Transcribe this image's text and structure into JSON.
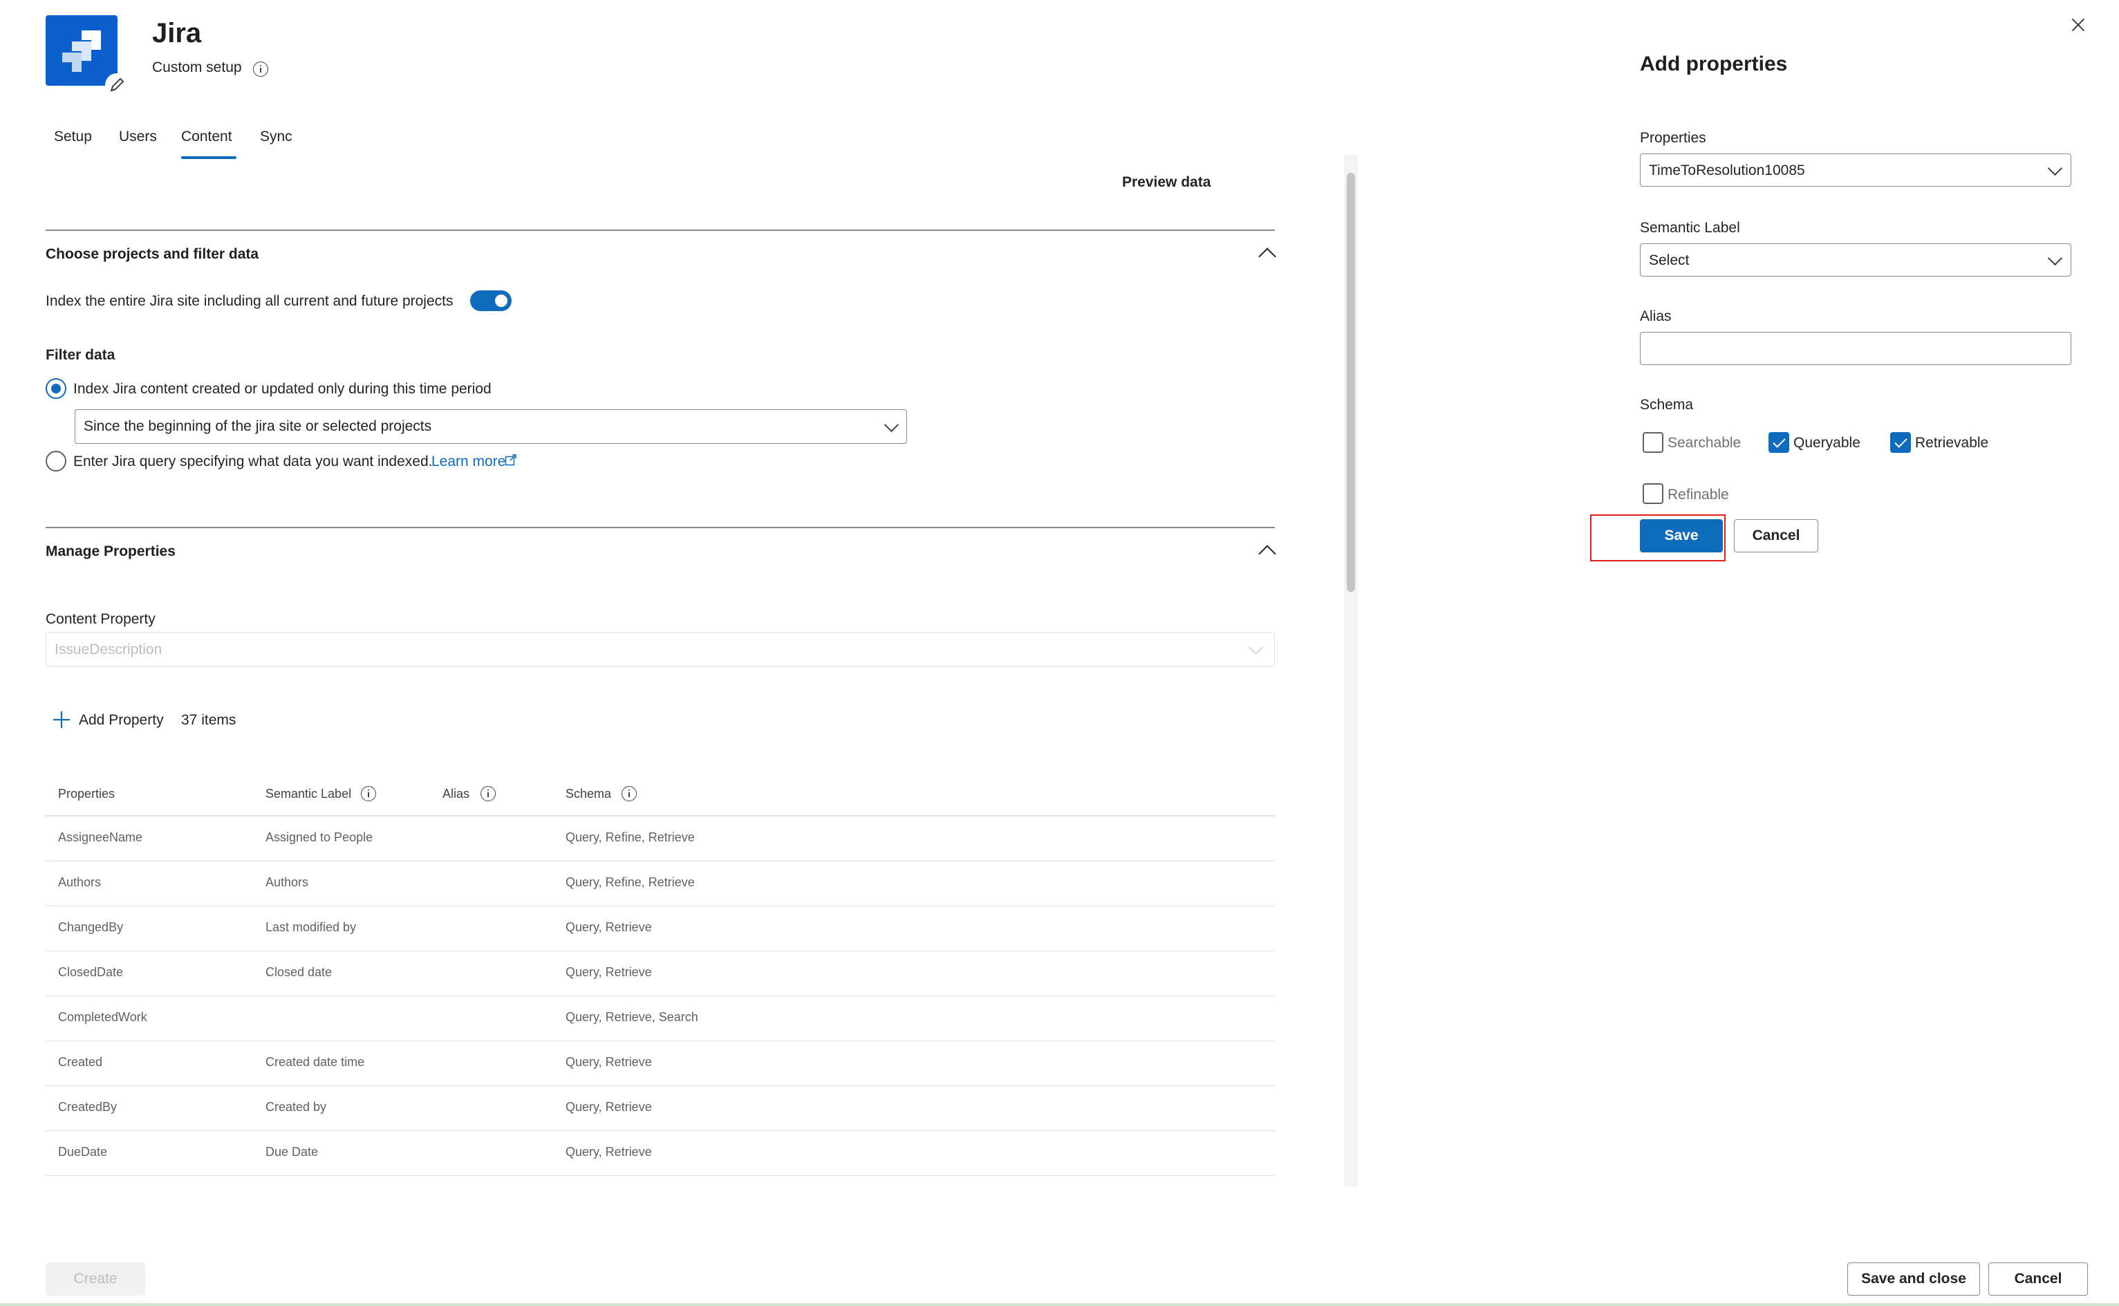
{
  "app": {
    "title": "Jira",
    "subtitle": "Custom setup"
  },
  "tabs": [
    {
      "label": "Setup"
    },
    {
      "label": "Users"
    },
    {
      "label": "Content",
      "active": true
    },
    {
      "label": "Sync"
    }
  ],
  "preview_data": "Preview data",
  "filter_section": {
    "title": "Choose projects and filter data",
    "index_entire_label": "Index the entire Jira site including all current and future projects",
    "index_entire_on": true,
    "filter_heading": "Filter data",
    "radio_time_period_label": "Index Jira content created or updated only during this time period",
    "time_period_value": "Since the beginning of the jira site or selected projects",
    "radio_query_label": "Enter Jira query specifying what data you want indexed.",
    "learn_more": "Learn more"
  },
  "manage_section": {
    "title": "Manage Properties",
    "content_property_label": "Content Property",
    "content_property_placeholder": "IssueDescription",
    "add_property": "Add Property",
    "items_count": "37 items",
    "columns": [
      "Properties",
      "Semantic Label",
      "Alias",
      "Schema"
    ],
    "rows": [
      {
        "property": "AssigneeName",
        "semantic": "Assigned to People",
        "alias": "",
        "schema": "Query, Refine, Retrieve"
      },
      {
        "property": "Authors",
        "semantic": "Authors",
        "alias": "",
        "schema": "Query, Refine, Retrieve"
      },
      {
        "property": "ChangedBy",
        "semantic": "Last modified by",
        "alias": "",
        "schema": "Query, Retrieve"
      },
      {
        "property": "ClosedDate",
        "semantic": "Closed date",
        "alias": "",
        "schema": "Query, Retrieve"
      },
      {
        "property": "CompletedWork",
        "semantic": "",
        "alias": "",
        "schema": "Query, Retrieve, Search"
      },
      {
        "property": "Created",
        "semantic": "Created date time",
        "alias": "",
        "schema": "Query, Retrieve"
      },
      {
        "property": "CreatedBy",
        "semantic": "Created by",
        "alias": "",
        "schema": "Query, Retrieve"
      },
      {
        "property": "DueDate",
        "semantic": "Due Date",
        "alias": "",
        "schema": "Query, Retrieve"
      }
    ]
  },
  "footer": {
    "create": "Create",
    "save_and_close": "Save and close",
    "cancel": "Cancel"
  },
  "panel": {
    "title": "Add properties",
    "properties_label": "Properties",
    "properties_value": "TimeToResolution10085",
    "semantic_label": "Semantic Label",
    "semantic_value": "Select",
    "alias_label": "Alias",
    "alias_value": "",
    "schema_label": "Schema",
    "schema": {
      "searchable": {
        "label": "Searchable",
        "checked": false
      },
      "queryable": {
        "label": "Queryable",
        "checked": true
      },
      "retrievable": {
        "label": "Retrievable",
        "checked": true
      },
      "refinable": {
        "label": "Refinable",
        "checked": false
      }
    },
    "save": "Save",
    "cancel": "Cancel"
  },
  "colors": {
    "accent": "#0f6cbd",
    "logo": "#0b5fcc",
    "highlight": "#e02020"
  }
}
